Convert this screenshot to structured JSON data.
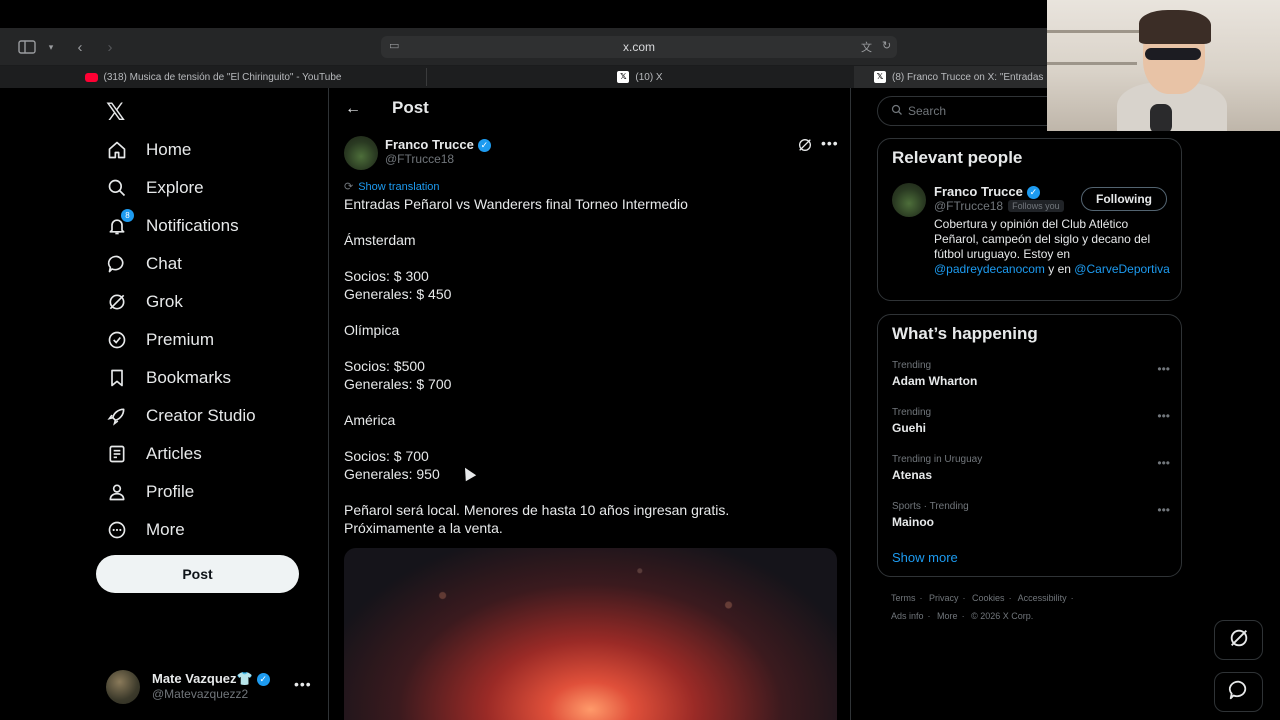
{
  "browser": {
    "url": "x.com",
    "tabs": [
      {
        "title": "(318) Musica de tensión de \"El Chiringuito\" - YouTube",
        "favicon": "youtube-icon"
      },
      {
        "title": "(10) X",
        "favicon": "x-icon"
      },
      {
        "title": "(8) Franco Trucce on X: \"Entradas",
        "favicon": "x-icon"
      }
    ]
  },
  "nav": {
    "items": [
      {
        "label": "Home",
        "icon": "home-icon"
      },
      {
        "label": "Explore",
        "icon": "search-icon"
      },
      {
        "label": "Notifications",
        "icon": "bell-icon",
        "badge": "8"
      },
      {
        "label": "Chat",
        "icon": "chat-icon"
      },
      {
        "label": "Grok",
        "icon": "grok-icon"
      },
      {
        "label": "Premium",
        "icon": "premium-icon"
      },
      {
        "label": "Bookmarks",
        "icon": "bookmark-icon"
      },
      {
        "label": "Creator Studio",
        "icon": "rocket-icon"
      },
      {
        "label": "Articles",
        "icon": "articles-icon"
      },
      {
        "label": "Profile",
        "icon": "person-icon"
      },
      {
        "label": "More",
        "icon": "more-circle-icon"
      }
    ],
    "post_button": "Post",
    "account": {
      "name": "Mate Vazquez👕",
      "handle": "@Matevazquezz2"
    }
  },
  "main": {
    "title": "Post",
    "author": {
      "name": "Franco Trucce",
      "handle": "@FTrucce18"
    },
    "show_translation": "Show translation",
    "text": "Entradas Peñarol vs Wanderers final Torneo Intermedio\n\nÁmsterdam\n\nSocios: $ 300\nGenerales: $ 450\n\nOlímpica\n\nSocios: $500\nGenerales: $ 700\n\nAmérica\n\nSocios: $ 700\nGenerales: 950\n\nPeñarol será local. Menores de hasta 10 años ingresan gratis.\nPróximamente a la venta."
  },
  "sidebar": {
    "search_placeholder": "Search",
    "relevant_people": {
      "title": "Relevant people",
      "name": "Franco Trucce",
      "handle": "@FTrucce18",
      "follows_you": "Follows you",
      "button": "Following",
      "bio_text": "Cobertura y opinión del Club Atlético Peñarol, campeón del siglo y decano del fútbol uruguayo. Estoy en",
      "bio_link1": "@padreydecanocom",
      "bio_mid": "y en",
      "bio_link2": "@CarveDeportiva"
    },
    "happening": {
      "title": "What’s happening",
      "trends": [
        {
          "meta": "Trending",
          "name": "Adam Wharton"
        },
        {
          "meta": "Trending",
          "name": "Guehi"
        },
        {
          "meta": "Trending in Uruguay",
          "name": "Atenas"
        },
        {
          "meta": "Sports · Trending",
          "name": "Mainoo"
        }
      ],
      "show_more": "Show more"
    },
    "footer": {
      "row1": [
        "Terms",
        "Privacy",
        "Cookies",
        "Accessibility"
      ],
      "row2": [
        "Ads info",
        "More",
        "© 2026 X Corp."
      ]
    }
  },
  "colors": {
    "accent": "#1d9bf0",
    "background": "#000000",
    "border": "#2f3336",
    "muted": "#71767b"
  }
}
